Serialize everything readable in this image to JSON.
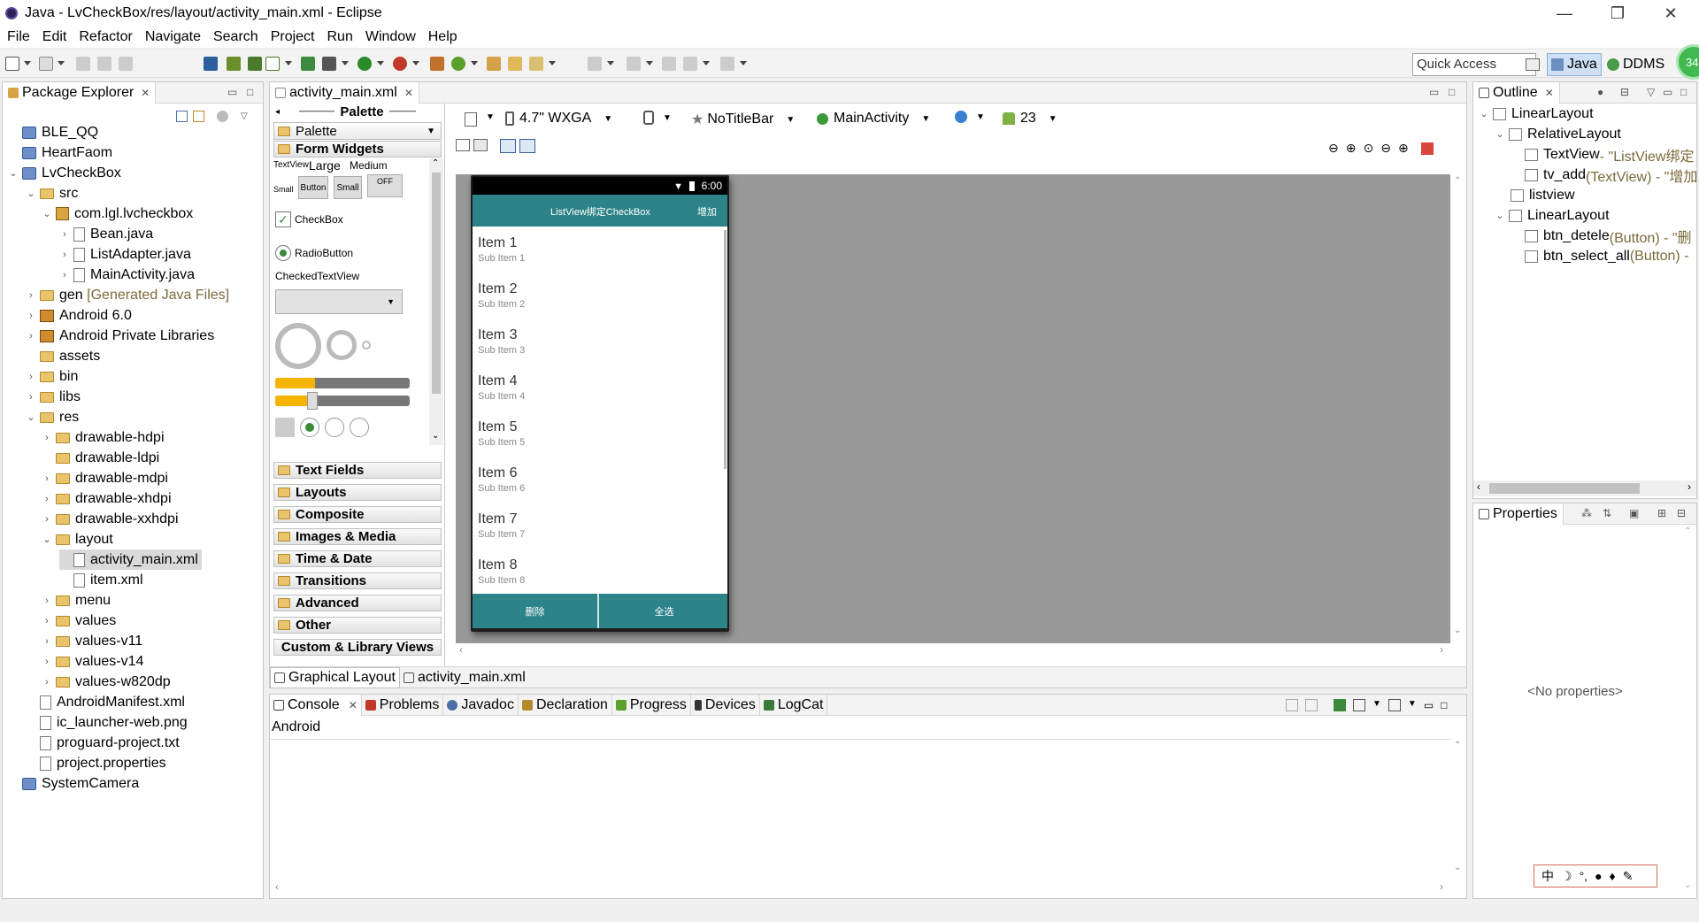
{
  "window": {
    "title": "Java - LvCheckBox/res/layout/activity_main.xml - Eclipse",
    "controls": {
      "minimize": "—",
      "maximize": "❐",
      "close": "✕"
    }
  },
  "menu": [
    "File",
    "Edit",
    "Refactor",
    "Navigate",
    "Search",
    "Project",
    "Run",
    "Window",
    "Help"
  ],
  "toolbar": {
    "quick_access": "Quick Access",
    "perspectives": {
      "java": "Java",
      "ddms": "DDMS",
      "badge": "34"
    }
  },
  "package_explorer": {
    "title": "Package Explorer",
    "items": [
      {
        "label": "BLE_QQ",
        "icon": "project-icon"
      },
      {
        "label": "HeartFaom",
        "icon": "project-icon"
      },
      {
        "label": "LvCheckBox",
        "icon": "project-icon"
      },
      {
        "label": "src",
        "icon": "src-folder-icon"
      },
      {
        "label": "com.lgl.lvcheckbox",
        "icon": "package-icon"
      },
      {
        "label": "Bean.java",
        "icon": "java-file-icon"
      },
      {
        "label": "ListAdapter.java",
        "icon": "java-file-icon"
      },
      {
        "label": "MainActivity.java",
        "icon": "java-file-icon"
      },
      {
        "label": "gen",
        "extra": "[Generated Java Files]",
        "icon": "gen-folder-icon"
      },
      {
        "label": "Android 6.0",
        "icon": "library-icon"
      },
      {
        "label": "Android Private Libraries",
        "icon": "library-icon"
      },
      {
        "label": "assets",
        "icon": "folder-icon"
      },
      {
        "label": "bin",
        "icon": "folder-icon"
      },
      {
        "label": "libs",
        "icon": "folder-icon"
      },
      {
        "label": "res",
        "icon": "folder-icon"
      },
      {
        "label": "drawable-hdpi",
        "icon": "folder-icon"
      },
      {
        "label": "drawable-ldpi",
        "icon": "folder-icon"
      },
      {
        "label": "drawable-mdpi",
        "icon": "folder-icon"
      },
      {
        "label": "drawable-xhdpi",
        "icon": "folder-icon"
      },
      {
        "label": "drawable-xxhdpi",
        "icon": "folder-icon"
      },
      {
        "label": "layout",
        "icon": "folder-icon"
      },
      {
        "label": "activity_main.xml",
        "icon": "xml-file-icon"
      },
      {
        "label": "item.xml",
        "icon": "xml-file-icon"
      },
      {
        "label": "menu",
        "icon": "folder-icon"
      },
      {
        "label": "values",
        "icon": "folder-icon"
      },
      {
        "label": "values-v11",
        "icon": "folder-icon"
      },
      {
        "label": "values-v14",
        "icon": "folder-icon"
      },
      {
        "label": "values-w820dp",
        "icon": "folder-icon"
      },
      {
        "label": "AndroidManifest.xml",
        "icon": "xml-file-icon"
      },
      {
        "label": "ic_launcher-web.png",
        "icon": "image-file-icon"
      },
      {
        "label": "proguard-project.txt",
        "icon": "text-file-icon"
      },
      {
        "label": "project.properties",
        "icon": "text-file-icon"
      },
      {
        "label": "SystemCamera",
        "icon": "project-icon"
      }
    ]
  },
  "editor": {
    "tab": "activity_main.xml",
    "palette_header": "Palette",
    "palette_dropdown": "Palette",
    "widgets": {
      "textview": "TextView",
      "large": "Large",
      "medium": "Medium",
      "small": "Small",
      "button": "Button",
      "small_btn": "Small",
      "off": "OFF",
      "checkbox": "CheckBox",
      "radiobutton": "RadioButton",
      "checked_textview": "CheckedTextView"
    },
    "sections": [
      "Form Widgets",
      "Text Fields",
      "Layouts",
      "Composite",
      "Images & Media",
      "Time & Date",
      "Transitions",
      "Advanced",
      "Other",
      "Custom & Library Views"
    ],
    "config": {
      "device": "4.7\" WXGA",
      "theme": "NoTitleBar",
      "activity": "MainActivity",
      "api": "23"
    },
    "bottom_tabs": [
      "Graphical Layout",
      "activity_main.xml"
    ]
  },
  "phone": {
    "time": "6:00",
    "app_title": "ListView绑定CheckBox",
    "add_btn": "增加",
    "items": [
      {
        "title": "Item 1",
        "sub": "Sub Item 1"
      },
      {
        "title": "Item 2",
        "sub": "Sub Item 2"
      },
      {
        "title": "Item 3",
        "sub": "Sub Item 3"
      },
      {
        "title": "Item 4",
        "sub": "Sub Item 4"
      },
      {
        "title": "Item 5",
        "sub": "Sub Item 5"
      },
      {
        "title": "Item 6",
        "sub": "Sub Item 6"
      },
      {
        "title": "Item 7",
        "sub": "Sub Item 7"
      },
      {
        "title": "Item 8",
        "sub": "Sub Item 8"
      }
    ],
    "delete_btn": "删除",
    "select_all_btn": "全选"
  },
  "console": {
    "tabs": [
      "Console",
      "Problems",
      "Javadoc",
      "Declaration",
      "Progress",
      "Devices",
      "LogCat"
    ],
    "content_title": "Android"
  },
  "outline": {
    "title": "Outline",
    "items": [
      {
        "label": "LinearLayout",
        "extra": ""
      },
      {
        "label": "RelativeLayout",
        "extra": ""
      },
      {
        "label": "TextView",
        "extra": " - \"ListView绑定"
      },
      {
        "label": "tv_add",
        "extra": " (TextView) - \"增加"
      },
      {
        "label": "listview",
        "extra": ""
      },
      {
        "label": "LinearLayout",
        "extra": ""
      },
      {
        "label": "btn_detele",
        "extra": " (Button) - \"删"
      },
      {
        "label": "btn_select_all",
        "extra": " (Button) -"
      }
    ]
  },
  "properties": {
    "title": "Properties",
    "empty": "<No properties>"
  },
  "ime": {
    "label": "中"
  },
  "colors": {
    "accent": "#2c8388",
    "canvas": "#999999"
  }
}
